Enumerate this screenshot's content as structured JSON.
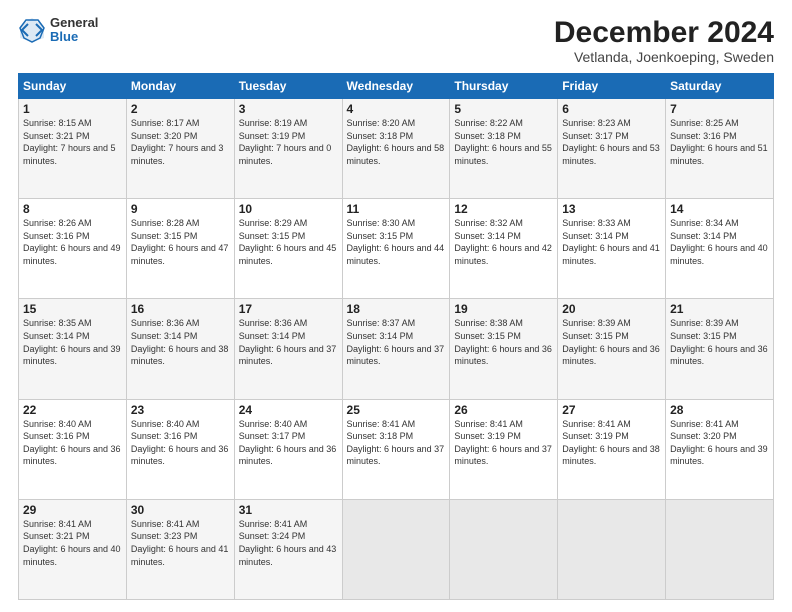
{
  "logo": {
    "general": "General",
    "blue": "Blue"
  },
  "title": {
    "main": "December 2024",
    "sub": "Vetlanda, Joenkoeping, Sweden"
  },
  "headers": [
    "Sunday",
    "Monday",
    "Tuesday",
    "Wednesday",
    "Thursday",
    "Friday",
    "Saturday"
  ],
  "weeks": [
    [
      {
        "day": "1",
        "sunrise": "8:15 AM",
        "sunset": "3:21 PM",
        "daylight": "7 hours and 5 minutes."
      },
      {
        "day": "2",
        "sunrise": "8:17 AM",
        "sunset": "3:20 PM",
        "daylight": "7 hours and 3 minutes."
      },
      {
        "day": "3",
        "sunrise": "8:19 AM",
        "sunset": "3:19 PM",
        "daylight": "7 hours and 0 minutes."
      },
      {
        "day": "4",
        "sunrise": "8:20 AM",
        "sunset": "3:18 PM",
        "daylight": "6 hours and 58 minutes."
      },
      {
        "day": "5",
        "sunrise": "8:22 AM",
        "sunset": "3:18 PM",
        "daylight": "6 hours and 55 minutes."
      },
      {
        "day": "6",
        "sunrise": "8:23 AM",
        "sunset": "3:17 PM",
        "daylight": "6 hours and 53 minutes."
      },
      {
        "day": "7",
        "sunrise": "8:25 AM",
        "sunset": "3:16 PM",
        "daylight": "6 hours and 51 minutes."
      }
    ],
    [
      {
        "day": "8",
        "sunrise": "8:26 AM",
        "sunset": "3:16 PM",
        "daylight": "6 hours and 49 minutes."
      },
      {
        "day": "9",
        "sunrise": "8:28 AM",
        "sunset": "3:15 PM",
        "daylight": "6 hours and 47 minutes."
      },
      {
        "day": "10",
        "sunrise": "8:29 AM",
        "sunset": "3:15 PM",
        "daylight": "6 hours and 45 minutes."
      },
      {
        "day": "11",
        "sunrise": "8:30 AM",
        "sunset": "3:15 PM",
        "daylight": "6 hours and 44 minutes."
      },
      {
        "day": "12",
        "sunrise": "8:32 AM",
        "sunset": "3:14 PM",
        "daylight": "6 hours and 42 minutes."
      },
      {
        "day": "13",
        "sunrise": "8:33 AM",
        "sunset": "3:14 PM",
        "daylight": "6 hours and 41 minutes."
      },
      {
        "day": "14",
        "sunrise": "8:34 AM",
        "sunset": "3:14 PM",
        "daylight": "6 hours and 40 minutes."
      }
    ],
    [
      {
        "day": "15",
        "sunrise": "8:35 AM",
        "sunset": "3:14 PM",
        "daylight": "6 hours and 39 minutes."
      },
      {
        "day": "16",
        "sunrise": "8:36 AM",
        "sunset": "3:14 PM",
        "daylight": "6 hours and 38 minutes."
      },
      {
        "day": "17",
        "sunrise": "8:36 AM",
        "sunset": "3:14 PM",
        "daylight": "6 hours and 37 minutes."
      },
      {
        "day": "18",
        "sunrise": "8:37 AM",
        "sunset": "3:14 PM",
        "daylight": "6 hours and 37 minutes."
      },
      {
        "day": "19",
        "sunrise": "8:38 AM",
        "sunset": "3:15 PM",
        "daylight": "6 hours and 36 minutes."
      },
      {
        "day": "20",
        "sunrise": "8:39 AM",
        "sunset": "3:15 PM",
        "daylight": "6 hours and 36 minutes."
      },
      {
        "day": "21",
        "sunrise": "8:39 AM",
        "sunset": "3:15 PM",
        "daylight": "6 hours and 36 minutes."
      }
    ],
    [
      {
        "day": "22",
        "sunrise": "8:40 AM",
        "sunset": "3:16 PM",
        "daylight": "6 hours and 36 minutes."
      },
      {
        "day": "23",
        "sunrise": "8:40 AM",
        "sunset": "3:16 PM",
        "daylight": "6 hours and 36 minutes."
      },
      {
        "day": "24",
        "sunrise": "8:40 AM",
        "sunset": "3:17 PM",
        "daylight": "6 hours and 36 minutes."
      },
      {
        "day": "25",
        "sunrise": "8:41 AM",
        "sunset": "3:18 PM",
        "daylight": "6 hours and 37 minutes."
      },
      {
        "day": "26",
        "sunrise": "8:41 AM",
        "sunset": "3:19 PM",
        "daylight": "6 hours and 37 minutes."
      },
      {
        "day": "27",
        "sunrise": "8:41 AM",
        "sunset": "3:19 PM",
        "daylight": "6 hours and 38 minutes."
      },
      {
        "day": "28",
        "sunrise": "8:41 AM",
        "sunset": "3:20 PM",
        "daylight": "6 hours and 39 minutes."
      }
    ],
    [
      {
        "day": "29",
        "sunrise": "8:41 AM",
        "sunset": "3:21 PM",
        "daylight": "6 hours and 40 minutes."
      },
      {
        "day": "30",
        "sunrise": "8:41 AM",
        "sunset": "3:23 PM",
        "daylight": "6 hours and 41 minutes."
      },
      {
        "day": "31",
        "sunrise": "8:41 AM",
        "sunset": "3:24 PM",
        "daylight": "6 hours and 43 minutes."
      },
      null,
      null,
      null,
      null
    ]
  ]
}
